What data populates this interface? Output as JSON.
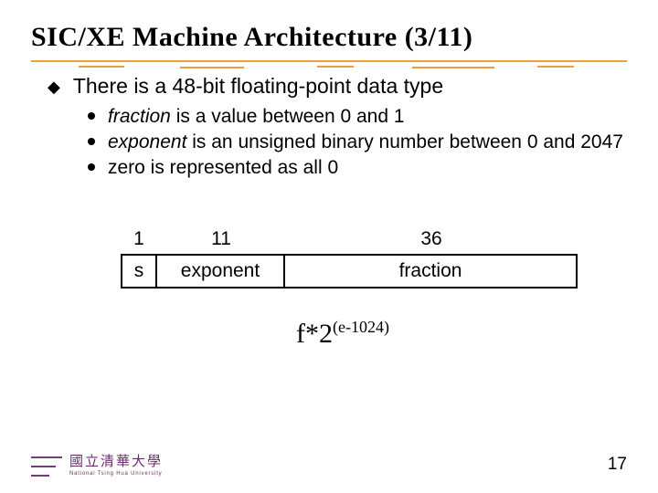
{
  "title": "SIC/XE Machine Architecture (3/11)",
  "main_point": "There is a 48-bit floating-point data type",
  "sub_points": [
    {
      "emph": "fraction",
      "rest": " is a value between 0 and 1"
    },
    {
      "emph": "exponent",
      "rest": " is an unsigned binary number between 0 and 2047"
    },
    {
      "emph": "",
      "rest": "zero is represented as all 0"
    }
  ],
  "field_layout": {
    "widths": [
      "1",
      "11",
      "36"
    ],
    "names": [
      "s",
      "exponent",
      "fraction"
    ]
  },
  "formula": {
    "base": "f*2",
    "sup": "(e-1024)"
  },
  "footer": {
    "uni_cn": "國立清華大學",
    "uni_en": "National Tsing Hua University"
  },
  "page_number": "17"
}
